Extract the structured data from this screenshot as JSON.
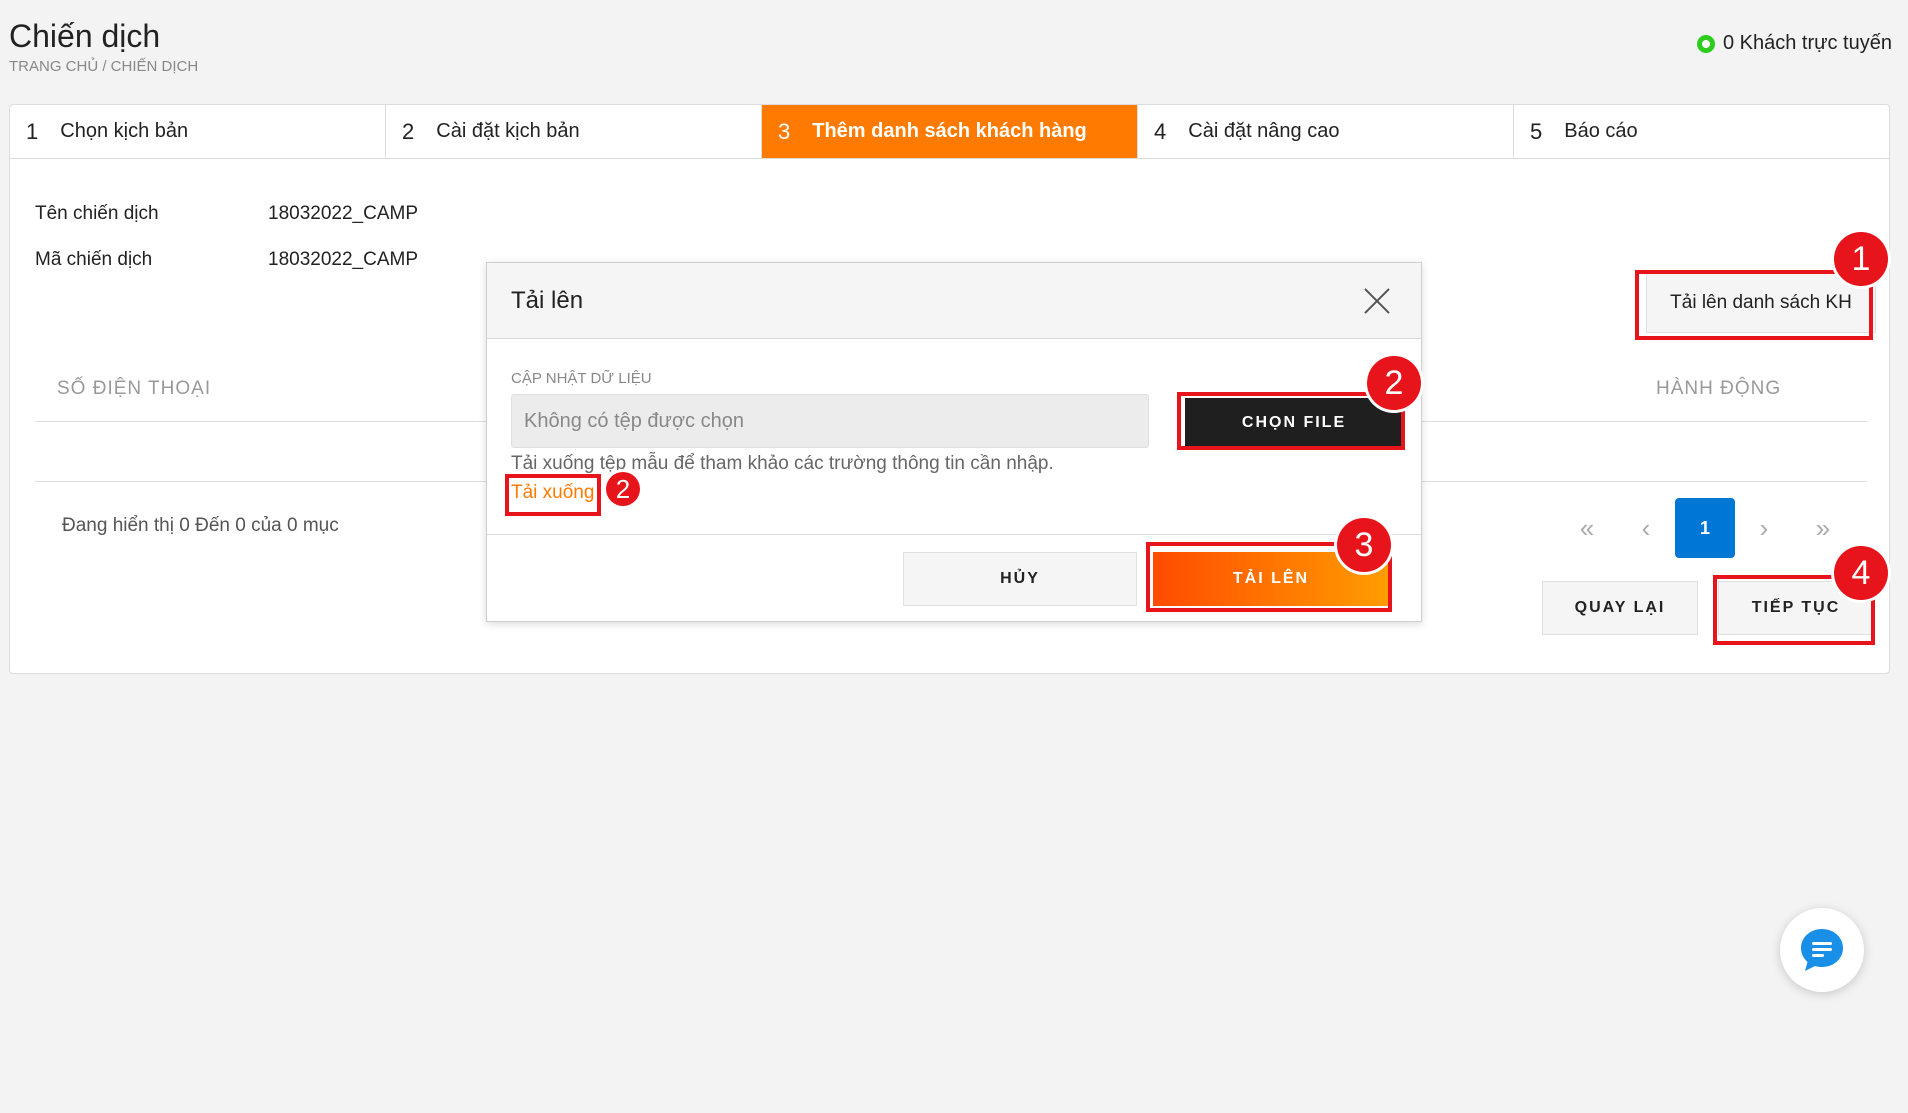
{
  "header": {
    "title": "Chiến dịch",
    "breadcrumb": "TRANG CHỦ / CHIẾN DỊCH",
    "online_text": "0 Khách trực tuyến"
  },
  "steps": [
    {
      "num": "1",
      "label": "Chọn kịch bản"
    },
    {
      "num": "2",
      "label": "Cài đặt kịch bản"
    },
    {
      "num": "3",
      "label": "Thêm danh sách khách hàng",
      "active": true
    },
    {
      "num": "4",
      "label": "Cài đặt nâng cao"
    },
    {
      "num": "5",
      "label": "Báo cáo"
    }
  ],
  "campaign": {
    "name_label": "Tên chiến dịch",
    "name_value": "18032022_CAMP",
    "code_label": "Mã chiến dịch",
    "code_value": "18032022_CAMP"
  },
  "upload_list_button": "Tải lên danh sách KH",
  "table": {
    "col_phone": "SỐ ĐIỆN THOẠI",
    "col_action": "HÀNH ĐỘNG",
    "showing": "Đang hiển thị 0 Đến 0 của 0 mục"
  },
  "pagination": {
    "first": "«",
    "prev": "‹",
    "current": "1",
    "next": "›",
    "last": "»"
  },
  "buttons": {
    "back": "QUAY LẠI",
    "next": "TIẾP TỤC"
  },
  "modal": {
    "title": "Tải lên",
    "field_label": "CẬP NHẬT DỮ LIỆU",
    "file_placeholder": "Không có tệp được chọn",
    "choose_file": "CHỌN FILE",
    "hint": "Tải xuống tệp mẫu để tham khảo các trường thông tin cần nhập.",
    "download_link": "Tải xuống",
    "cancel": "HỦY",
    "upload": "TẢI LÊN"
  },
  "annotations": {
    "b1": "1",
    "b2a": "2",
    "b2b": "2",
    "b3": "3",
    "b4": "4"
  },
  "colors": {
    "accent": "#ff7a00",
    "primary": "#0077d4",
    "annotation": "#e8141b",
    "online": "#2ecc1f"
  },
  "icons": {
    "close": "close-icon",
    "chat": "chat-bubble-icon",
    "online": "online-dot-icon"
  }
}
